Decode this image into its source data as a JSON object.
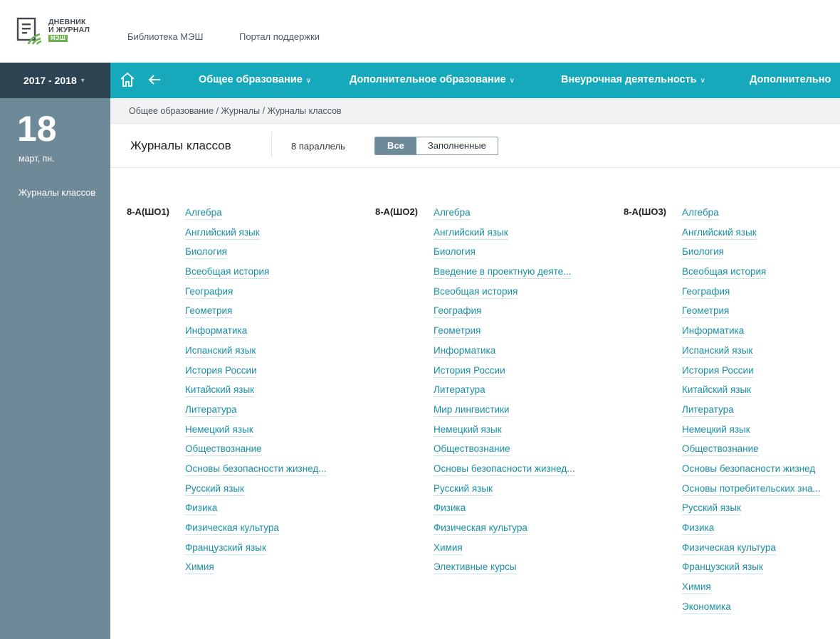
{
  "header": {
    "logo": {
      "line1": "ДНЕВНИК",
      "line2": "И ЖУРНАЛ",
      "badge": "МЭШ"
    },
    "links": [
      "Библиотека МЭШ",
      "Портал поддержки"
    ]
  },
  "year": {
    "label": "2017 - 2018",
    "caret": "▾"
  },
  "nav": {
    "items": [
      {
        "label": "Общее образование"
      },
      {
        "label": "Дополнительное образование"
      },
      {
        "label": "Внеурочная деятельность"
      },
      {
        "label": "Дополнительно"
      }
    ]
  },
  "sidebar": {
    "day": "18",
    "day_label": "март, пн.",
    "link": "Журналы классов"
  },
  "breadcrumb": "Общее образование / Журналы / Журналы классов",
  "page": {
    "title": "Журналы классов",
    "parallel": "8 параллель",
    "filter": [
      "Все",
      "Заполненные"
    ]
  },
  "classes": [
    {
      "name": "8-А(ШО1)",
      "subjects": [
        "Алгебра",
        "Английский язык",
        "Биология",
        "Всеобщая история",
        "География",
        "Геометрия",
        "Информатика",
        "Испанский язык",
        "История России",
        "Китайский язык",
        "Литература",
        "Немецкий язык",
        "Обществознание",
        "Основы безопасности жизнед...",
        "Русский язык",
        "Физика",
        "Физическая культура",
        "Французский язык",
        "Химия"
      ]
    },
    {
      "name": "8-А(ШО2)",
      "subjects": [
        "Алгебра",
        "Английский язык",
        "Биология",
        "Введение в проектную деяте...",
        "Всеобщая история",
        "География",
        "Геометрия",
        "Информатика",
        "История России",
        "Литература",
        "Мир лингвистики",
        "Немецкий язык",
        "Обществознание",
        "Основы безопасности жизнед...",
        "Русский язык",
        "Физика",
        "Физическая культура",
        "Химия",
        "Элективные курсы"
      ]
    },
    {
      "name": "8-А(ШО3)",
      "subjects": [
        "Алгебра",
        "Английский язык",
        "Биология",
        "Всеобщая история",
        "География",
        "Геометрия",
        "Информатика",
        "Испанский язык",
        "История России",
        "Китайский язык",
        "Литература",
        "Немецкий язык",
        "Обществознание",
        "Основы безопасности жизнед",
        "Основы потребительских зна...",
        "Русский язык",
        "Физика",
        "Физическая культура",
        "Французский язык",
        "Химия",
        "Экономика"
      ]
    }
  ],
  "colors": {
    "nav": "#16a9bb",
    "year": "#2c4452",
    "sidebar": "#6e8a99",
    "link": "#1a8fa5"
  }
}
